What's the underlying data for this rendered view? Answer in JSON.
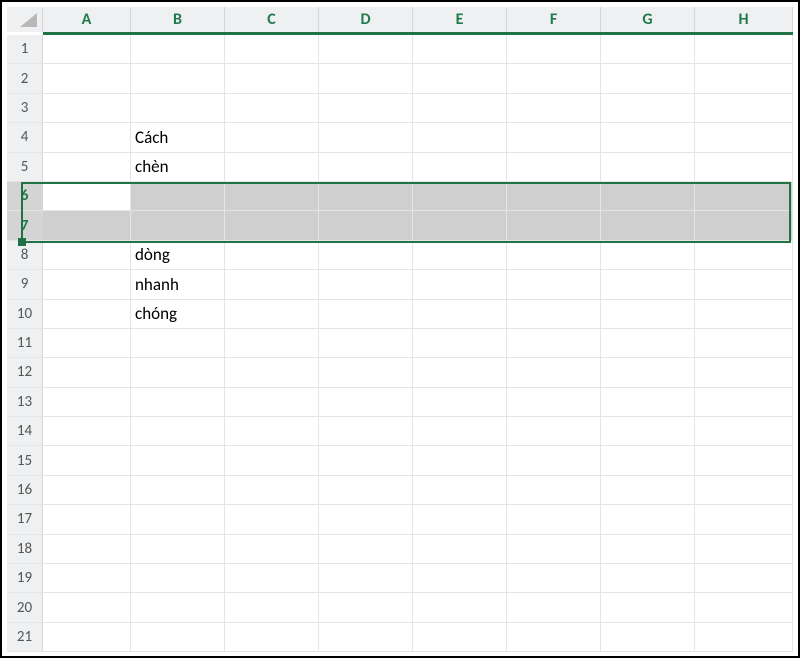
{
  "columns": [
    "A",
    "B",
    "C",
    "D",
    "E",
    "F",
    "G",
    "H"
  ],
  "rows": [
    1,
    2,
    3,
    4,
    5,
    6,
    7,
    8,
    9,
    10,
    11,
    12,
    13,
    14,
    15,
    16,
    17,
    18,
    19,
    20,
    21
  ],
  "selectedRows": [
    6,
    7
  ],
  "activeCell": "A6",
  "cells": {
    "B4": "Cách",
    "B5": "chèn",
    "B8": "dòng",
    "B9": "nhanh",
    "B10": "chóng"
  }
}
